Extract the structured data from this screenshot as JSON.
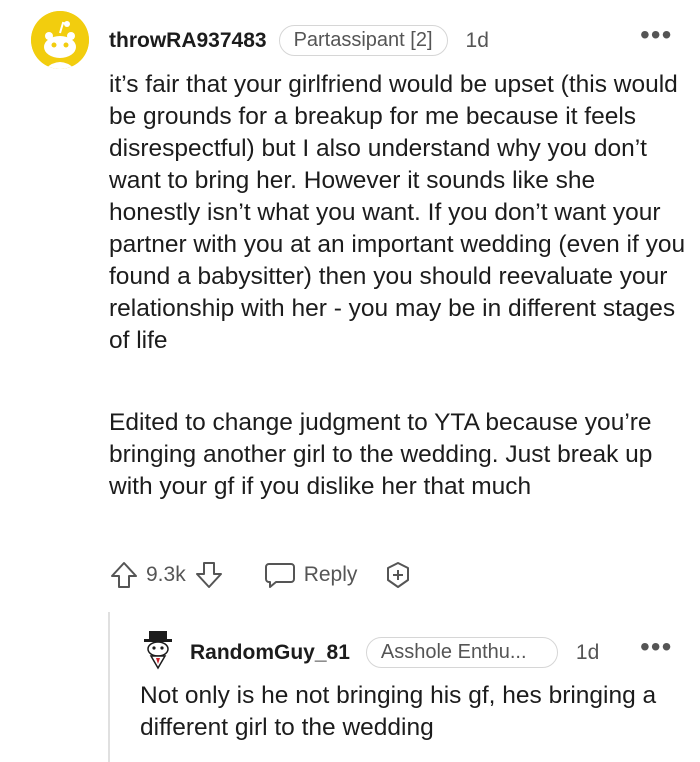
{
  "comment": {
    "username": "throwRA937483",
    "flair": "Partassipant [2]",
    "time": "1d",
    "more": "•••",
    "paragraph1": "it’s fair that your girlfriend would be upset (this would be grounds for a breakup for me because it feels disrespectful) but I also understand why you don’t want to bring her. However it sounds like she honestly isn’t what you want. If you don’t want your partner with you at an important wedding (even if you found a babysitter) then you should reevaluate your relationship with her - you may be in different stages of life",
    "paragraph2": "Edited to change judgment to YTA because you’re bringing another girl to the wedding. Just break up with your gf if you dislike her that much",
    "vote_count": "9.3k",
    "reply_label": "Reply"
  },
  "reply": {
    "username": "RandomGuy_81",
    "flair": "Asshole Enthu...",
    "time": "1d",
    "more": "•••",
    "text": "Not only is he not bringing his gf, hes bringing a different girl to the wedding"
  },
  "colors": {
    "avatar_bg": "#f2cd0e",
    "text": "#1c1c1c",
    "meta": "#555555"
  }
}
